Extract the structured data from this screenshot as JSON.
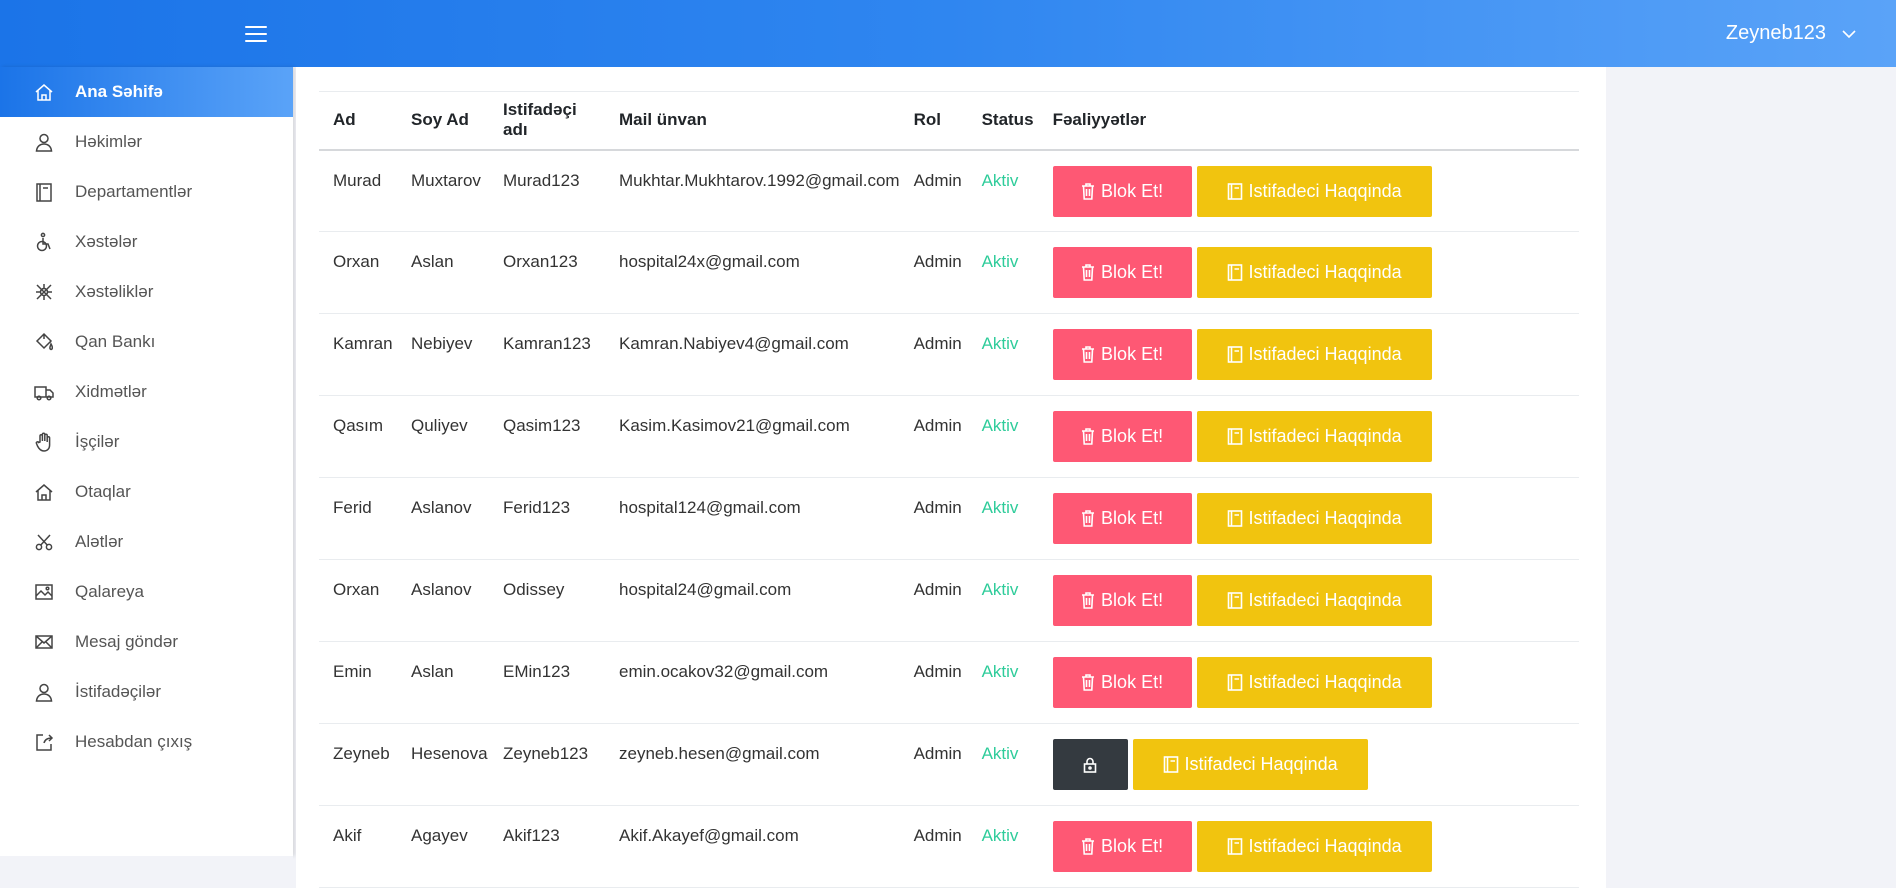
{
  "header": {
    "menu_icon": "hamburger-icon",
    "username": "Zeyneb123",
    "dropdown_icon": "chevron-down-icon"
  },
  "sidebar": {
    "items": [
      {
        "label": "Ana Səhifə",
        "icon": "home-icon",
        "active": true
      },
      {
        "label": "Həkimlər",
        "icon": "user-icon"
      },
      {
        "label": "Departamentlər",
        "icon": "book-icon"
      },
      {
        "label": "Xəstələr",
        "icon": "wheelchair-icon"
      },
      {
        "label": "Xəstəliklər",
        "icon": "virus-icon"
      },
      {
        "label": "Qan Bankı",
        "icon": "paint-bucket-icon"
      },
      {
        "label": "Xidmətlər",
        "icon": "truck-icon"
      },
      {
        "label": "İşçilər",
        "icon": "hand-icon"
      },
      {
        "label": "Otaqlar",
        "icon": "home-icon"
      },
      {
        "label": "Alətlər",
        "icon": "scissors-icon"
      },
      {
        "label": "Qalareya",
        "icon": "gallery-icon"
      },
      {
        "label": "Mesaj göndər",
        "icon": "envelope-icon"
      },
      {
        "label": "İstifadəçilər",
        "icon": "user-icon"
      },
      {
        "label": "Hesabdan çıxış",
        "icon": "logout-icon"
      }
    ]
  },
  "table": {
    "headers": [
      "Ad",
      "Soy Ad",
      "Istifadəçi adı",
      "Mail ünvan",
      "Rol",
      "Status",
      "Fəaliyyətlər"
    ],
    "block_label": "Blok Et!",
    "info_label": "Istifadeci Haqqinda",
    "rows": [
      {
        "ad": "Murad",
        "soyad": "Muxtarov",
        "username": "Murad123",
        "mail": "Mukhtar.Mukhtarov.1992@gmail.com",
        "rol": "Admin",
        "status": "Aktiv",
        "locked": false
      },
      {
        "ad": "Orxan",
        "soyad": "Aslan",
        "username": "Orxan123",
        "mail": "hospital24x@gmail.com",
        "rol": "Admin",
        "status": "Aktiv",
        "locked": false
      },
      {
        "ad": "Kamran",
        "soyad": "Nebiyev",
        "username": "Kamran123",
        "mail": "Kamran.Nabiyev4@gmail.com",
        "rol": "Admin",
        "status": "Aktiv",
        "locked": false
      },
      {
        "ad": "Qasım",
        "soyad": "Quliyev",
        "username": "Qasim123",
        "mail": "Kasim.Kasimov21@gmail.com",
        "rol": "Admin",
        "status": "Aktiv",
        "locked": false
      },
      {
        "ad": "Ferid",
        "soyad": "Aslanov",
        "username": "Ferid123",
        "mail": "hospital124@gmail.com",
        "rol": "Admin",
        "status": "Aktiv",
        "locked": false
      },
      {
        "ad": "Orxan",
        "soyad": "Aslanov",
        "username": "Odissey",
        "mail": "hospital24@gmail.com",
        "rol": "Admin",
        "status": "Aktiv",
        "locked": false
      },
      {
        "ad": "Emin",
        "soyad": "Aslan",
        "username": "EMin123",
        "mail": "emin.ocakov32@gmail.com",
        "rol": "Admin",
        "status": "Aktiv",
        "locked": false
      },
      {
        "ad": "Zeyneb",
        "soyad": "Hesenova",
        "username": "Zeyneb123",
        "mail": "zeyneb.hesen@gmail.com",
        "rol": "Admin",
        "status": "Aktiv",
        "locked": true
      },
      {
        "ad": "Akif",
        "soyad": "Agayev",
        "username": "Akif123",
        "mail": "Akif.Akayef@gmail.com",
        "rol": "Admin",
        "status": "Aktiv",
        "locked": false
      }
    ]
  },
  "colors": {
    "header_gradient_start": "#1b74e8",
    "header_gradient_end": "#5aa3f8",
    "block_button": "#fe5874",
    "info_button": "#f1c40f",
    "lock_button": "#343a40",
    "status_active": "#2ecc9a"
  }
}
